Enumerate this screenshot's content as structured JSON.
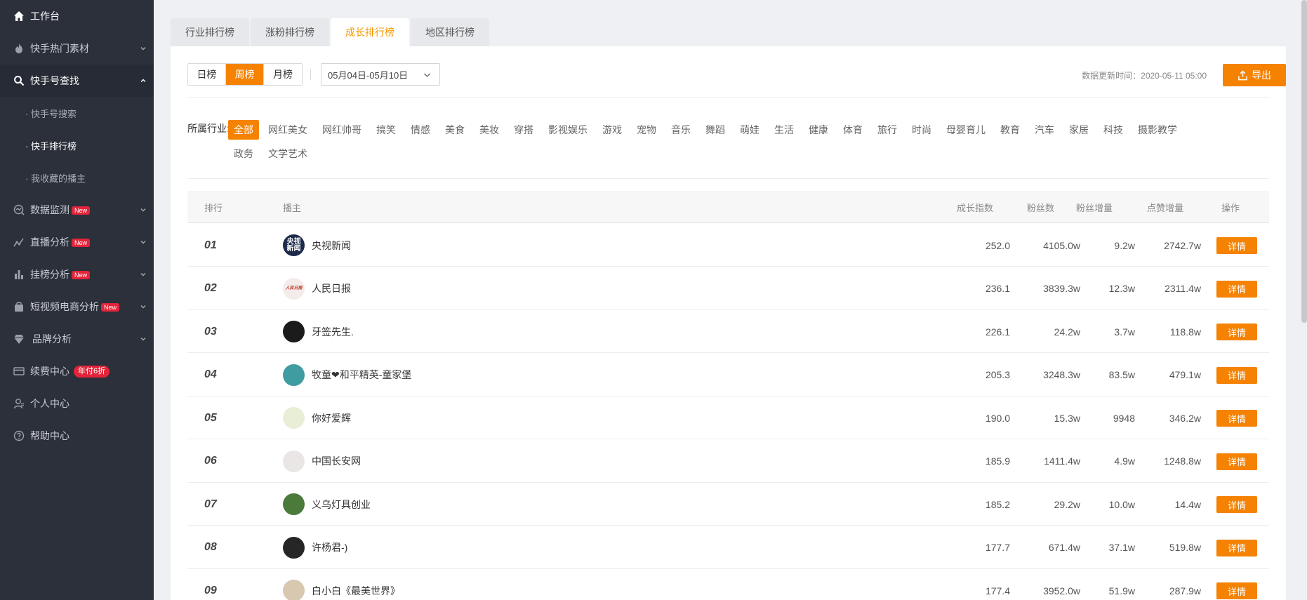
{
  "sidebar": {
    "home": "工作台",
    "items": [
      {
        "label": "快手热门素材",
        "icon": "fire-icon"
      },
      {
        "label": "快手号查找",
        "icon": "search-icon"
      },
      {
        "label": "数据监测",
        "icon": "monitor-icon",
        "badge": "New"
      },
      {
        "label": "直播分析",
        "icon": "line-chart-icon",
        "badge": "New"
      },
      {
        "label": "挂榜分析",
        "icon": "bar-chart-icon",
        "badge": "New"
      },
      {
        "label": "短视频电商分析",
        "icon": "shopping-bag-icon",
        "badge": "New"
      },
      {
        "label": "品牌分析",
        "icon": "diamond-icon"
      },
      {
        "label": "续费中心",
        "icon": "card-icon",
        "badge": "年付6折"
      },
      {
        "label": "个人中心",
        "icon": "user-icon"
      },
      {
        "label": "帮助中心",
        "icon": "help-icon"
      }
    ],
    "subitems": [
      "· 快手号搜索",
      "· 快手排行榜",
      "· 我收藏的播主"
    ]
  },
  "tabs": [
    "行业排行榜",
    "涨粉排行榜",
    "成长排行榜",
    "地区排行榜"
  ],
  "active_tab": "成长排行榜",
  "period": [
    "日榜",
    "周榜",
    "月榜"
  ],
  "active_period": "周榜",
  "date_range": "05月04日-05月10日",
  "update_text": "数据更新时间：2020-05-11 05:00",
  "export_label": "导出",
  "industry_label": "所属行业:",
  "industries_row1": [
    "全部",
    "网红美女",
    "网红帅哥",
    "搞笑",
    "情感",
    "美食",
    "美妆",
    "穿搭",
    "影视娱乐",
    "游戏",
    "宠物",
    "音乐",
    "舞蹈",
    "萌娃",
    "生活",
    "健康",
    "体育",
    "旅行",
    "时尚",
    "母婴育儿",
    "教育",
    "汽车",
    "家居",
    "科技",
    "摄影教学"
  ],
  "industries_row2": [
    "政务",
    "文学艺术"
  ],
  "table": {
    "headers": [
      "排行",
      "播主",
      "成长指数",
      "粉丝数",
      "粉丝增量",
      "点赞增量",
      "操作"
    ],
    "detail_label": "详情",
    "rows": [
      {
        "rank": "01",
        "name": "央视新闻",
        "avatar_text": "央视新闻",
        "growth": "252.0",
        "fans": "4105.0w",
        "fans_inc": "9.2w",
        "likes_inc": "2742.7w"
      },
      {
        "rank": "02",
        "name": "人民日报",
        "avatar_text": "人民日报",
        "growth": "236.1",
        "fans": "3839.3w",
        "fans_inc": "12.3w",
        "likes_inc": "2311.4w"
      },
      {
        "rank": "03",
        "name": "牙签先生.",
        "avatar_text": "",
        "growth": "226.1",
        "fans": "24.2w",
        "fans_inc": "3.7w",
        "likes_inc": "118.8w"
      },
      {
        "rank": "04",
        "name": "牧童❤和平精英-童家堡",
        "avatar_text": "",
        "growth": "205.3",
        "fans": "3248.3w",
        "fans_inc": "83.5w",
        "likes_inc": "479.1w"
      },
      {
        "rank": "05",
        "name": "你好爱辉",
        "avatar_text": "",
        "growth": "190.0",
        "fans": "15.3w",
        "fans_inc": "9948",
        "likes_inc": "346.2w"
      },
      {
        "rank": "06",
        "name": "中国长安网",
        "avatar_text": "",
        "growth": "185.9",
        "fans": "1411.4w",
        "fans_inc": "4.9w",
        "likes_inc": "1248.8w"
      },
      {
        "rank": "07",
        "name": "义乌灯具创业",
        "avatar_text": "",
        "growth": "185.2",
        "fans": "29.2w",
        "fans_inc": "10.0w",
        "likes_inc": "14.4w"
      },
      {
        "rank": "08",
        "name": "许杨君-)",
        "avatar_text": "",
        "growth": "177.7",
        "fans": "671.4w",
        "fans_inc": "37.1w",
        "likes_inc": "519.8w"
      },
      {
        "rank": "09",
        "name": "白小白《最美世界》",
        "avatar_text": "",
        "growth": "177.4",
        "fans": "3952.0w",
        "fans_inc": "51.9w",
        "likes_inc": "287.9w"
      }
    ]
  },
  "colors": {
    "accent": "#f58200",
    "sidebar_bg": "#2b303b",
    "badge": "#e4243a"
  }
}
